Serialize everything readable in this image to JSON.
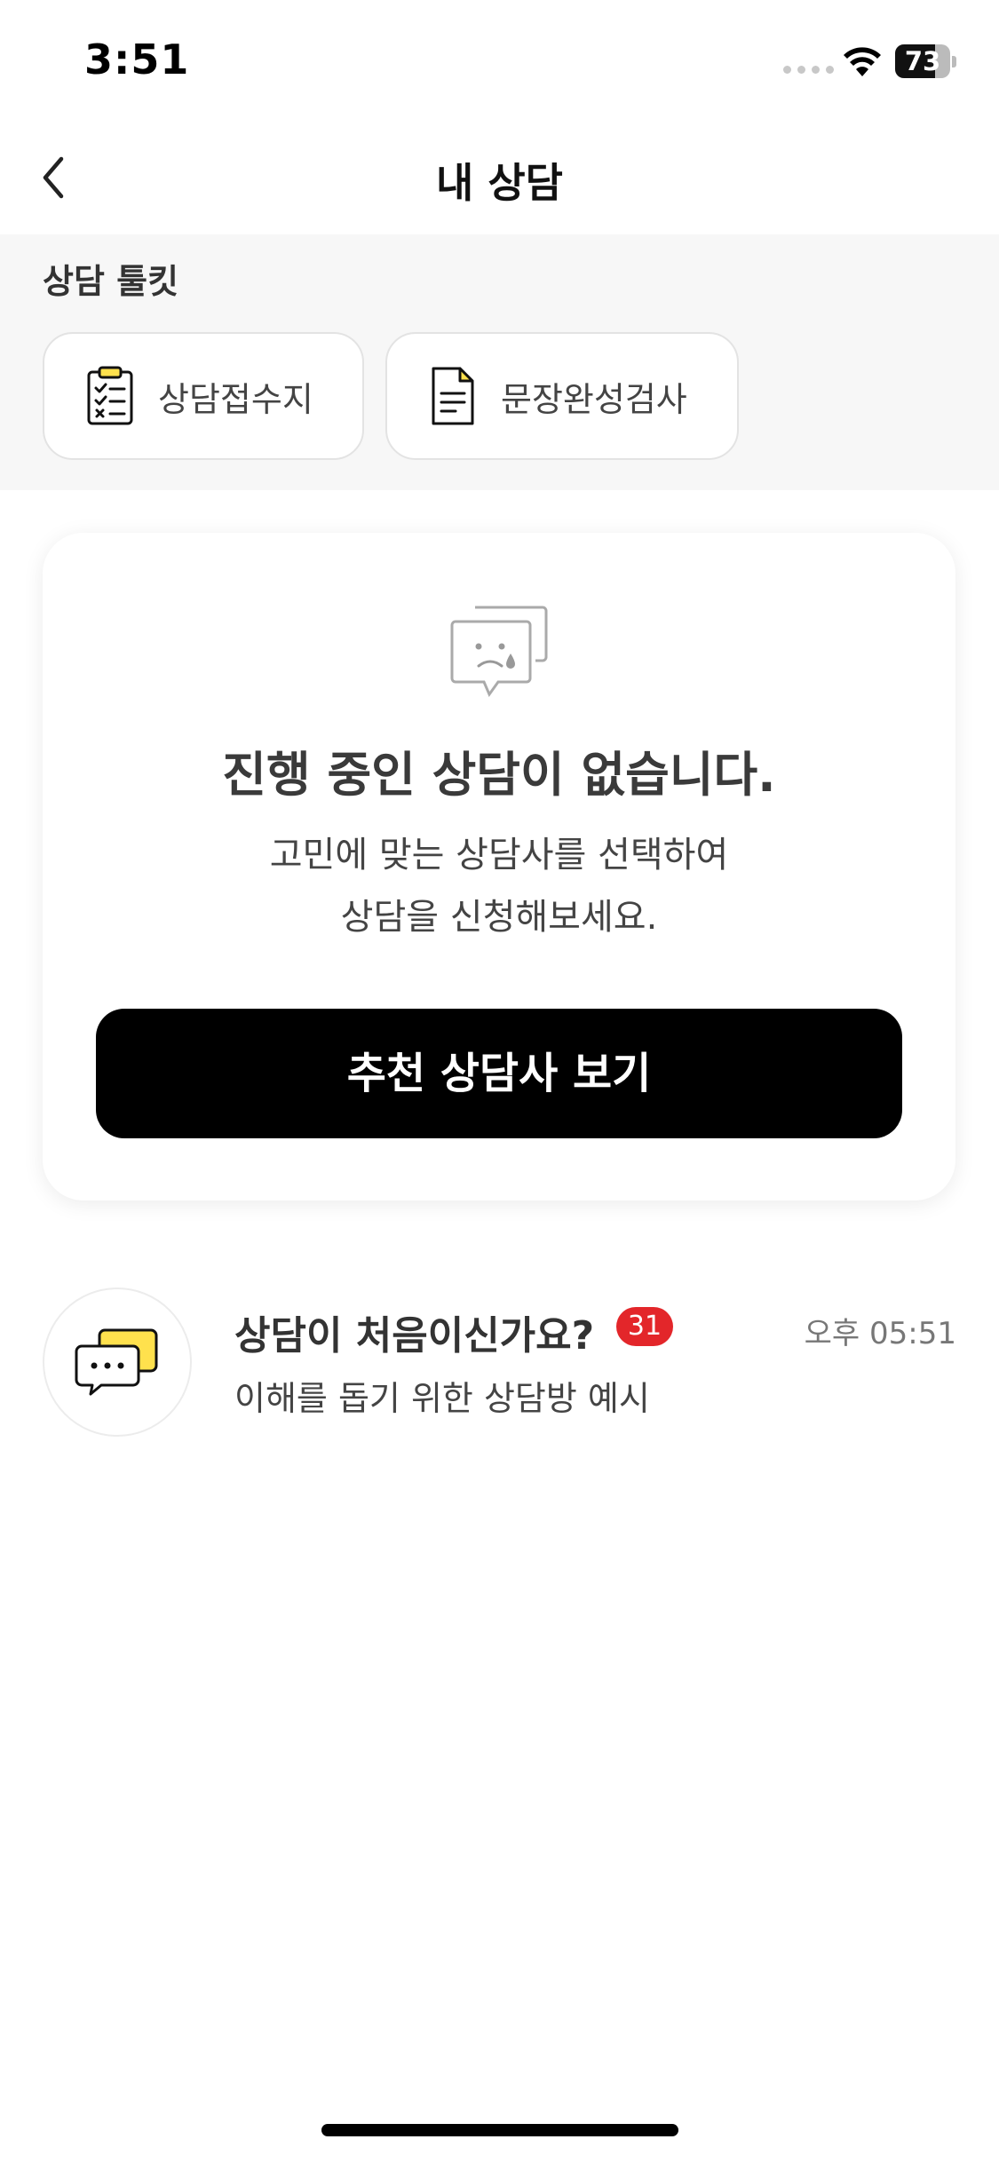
{
  "status_bar": {
    "time": "3:51",
    "battery_level": "73",
    "battery_fraction": 0.73
  },
  "header": {
    "title": "내 상담",
    "back_icon": "chevron-left-icon"
  },
  "toolkit": {
    "title": "상담 툴킷",
    "items": [
      {
        "label": "상담접수지",
        "icon": "clipboard-checklist-icon"
      },
      {
        "label": "문장완성검사",
        "icon": "document-icon"
      }
    ]
  },
  "empty_state": {
    "icon": "sad-chat-bubble-icon",
    "title": "진행 중인 상담이 없습니다.",
    "subtitle_line1": "고민에 맞는 상담사를 선택하여",
    "subtitle_line2": "상담을 신청해보세요.",
    "button_label": "추천 상담사 보기"
  },
  "chat_list": [
    {
      "title": "상담이 처음이신가요?",
      "badge": "31",
      "time": "오후 05:51",
      "preview": "이해를 돕기 위한 상담방 예시",
      "icon": "chat-bubbles-icon"
    }
  ],
  "colors": {
    "accent_yellow": "#FFE14D",
    "badge_red": "#E3262A",
    "cta_black": "#000000",
    "toolkit_bg": "#F7F7F7"
  }
}
